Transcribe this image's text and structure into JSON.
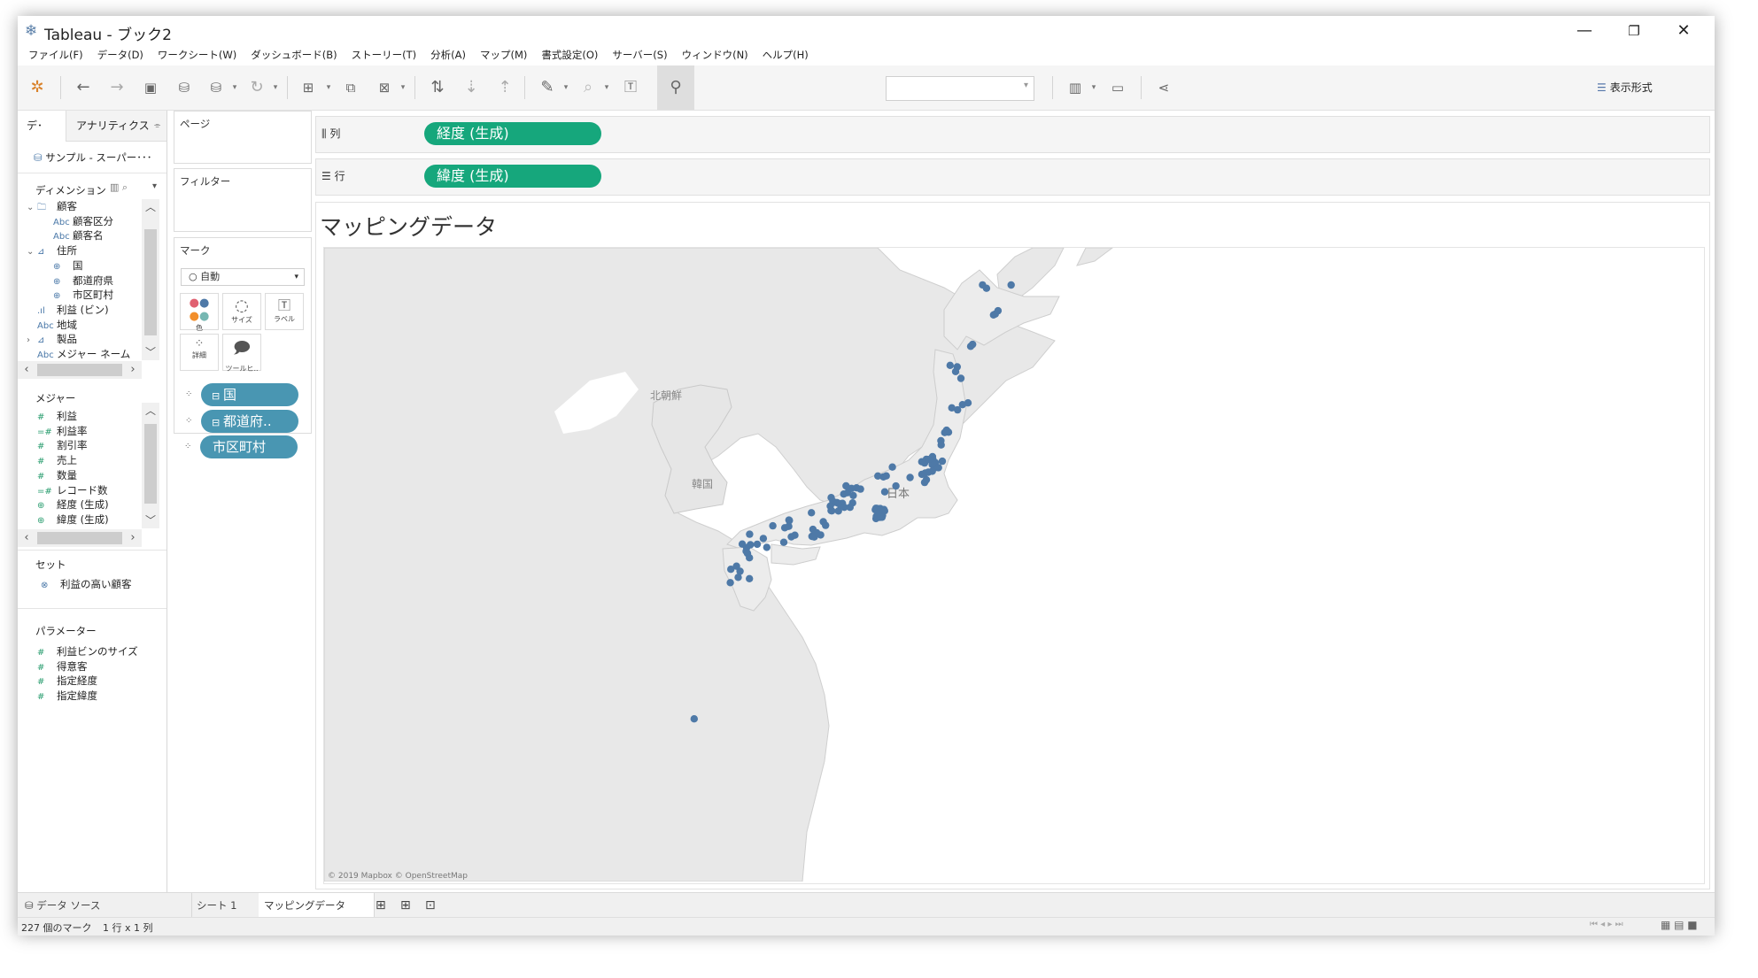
{
  "window": {
    "title": "Tableau - ブック2",
    "controls": {
      "minimize": "—",
      "restore": "❐",
      "close": "✕"
    }
  },
  "menu": [
    "ファイル(F)",
    "データ(D)",
    "ワークシート(W)",
    "ダッシュボード(B)",
    "ストーリー(T)",
    "分析(A)",
    "マップ(M)",
    "書式設定(O)",
    "サーバー(S)",
    "ウィンドウ(N)",
    "ヘルプ(H)"
  ],
  "toolbar": {
    "show_me": "表示形式",
    "fit_value": ""
  },
  "data_pane": {
    "tab_data": "デ･",
    "tab_analytics": "アナリティクス",
    "datasource": "サンプル - スーパー･･･",
    "dimensions_title": "ディメンション",
    "dimensions": [
      {
        "label": "顧客",
        "icon": "folder",
        "indent": 0,
        "twisty": "⌄"
      },
      {
        "label": "顧客区分",
        "icon": "Abc",
        "indent": 1
      },
      {
        "label": "顧客名",
        "icon": "Abc",
        "indent": 1
      },
      {
        "label": "住所",
        "icon": "hierarchy",
        "indent": 0,
        "twisty": "⌄"
      },
      {
        "label": "国",
        "icon": "globe",
        "indent": 1
      },
      {
        "label": "都道府県",
        "icon": "globe",
        "indent": 1
      },
      {
        "label": "市区町村",
        "icon": "globe",
        "indent": 1
      },
      {
        "label": "利益 (ビン)",
        "icon": "bin",
        "indent": 0
      },
      {
        "label": "地域",
        "icon": "Abc",
        "indent": 0
      },
      {
        "label": "製品",
        "icon": "hierarchy",
        "indent": 0,
        "twisty": "›"
      },
      {
        "label": "メジャー ネーム",
        "icon": "Abc",
        "indent": 0
      }
    ],
    "measures_title": "メジャー",
    "measures": [
      {
        "label": "利益",
        "icon": "#"
      },
      {
        "label": "利益率",
        "icon": "=#"
      },
      {
        "label": "割引率",
        "icon": "#"
      },
      {
        "label": "売上",
        "icon": "#"
      },
      {
        "label": "数量",
        "icon": "#"
      },
      {
        "label": "レコード数",
        "icon": "=#"
      },
      {
        "label": "経度 (生成)",
        "icon": "globe"
      },
      {
        "label": "緯度 (生成)",
        "icon": "globe"
      }
    ],
    "sets_title": "セット",
    "sets": [
      {
        "label": "利益の高い顧客"
      }
    ],
    "parameters_title": "パラメーター",
    "parameters": [
      {
        "label": "利益ビンのサイズ"
      },
      {
        "label": "得意客"
      },
      {
        "label": "指定経度"
      },
      {
        "label": "指定緯度"
      }
    ]
  },
  "cards": {
    "pages": "ページ",
    "filters": "フィルター",
    "marks": "マーク",
    "mark_type": "自動",
    "mark_buttons": [
      {
        "label": "色",
        "icon": "color-dots"
      },
      {
        "label": "サイズ",
        "icon": "size"
      },
      {
        "label": "ラベル",
        "icon": "label"
      },
      {
        "label": "詳細",
        "icon": "detail"
      },
      {
        "label": "ツールヒ..",
        "icon": "tooltip"
      }
    ],
    "detail_pills": [
      {
        "label": "国",
        "collapse": "⊟"
      },
      {
        "label": "都道府..",
        "collapse": "⊟"
      },
      {
        "label": "市区町村",
        "collapse": ""
      }
    ]
  },
  "shelves": {
    "columns_label": "列",
    "columns_pill": "経度 (生成)",
    "rows_label": "行",
    "rows_pill": "緯度 (生成)"
  },
  "view": {
    "title": "マッピングデータ",
    "map_labels": {
      "north_korea": "北朝鮮",
      "korea": "韓国",
      "japan": "日本"
    },
    "attribution": "© 2019 Mapbox © OpenStreetMap",
    "mark_color": "#4e79a7",
    "water_color": "#ffffff",
    "land_color": "#e8e8e8"
  },
  "sheet_tabs": {
    "datasource": "データ ソース",
    "tabs": [
      "シート 1",
      "マッピングデータ"
    ],
    "selected": "マッピングデータ"
  },
  "status": {
    "marks": "227 個のマーク",
    "grid": "1 行 x 1 列"
  }
}
